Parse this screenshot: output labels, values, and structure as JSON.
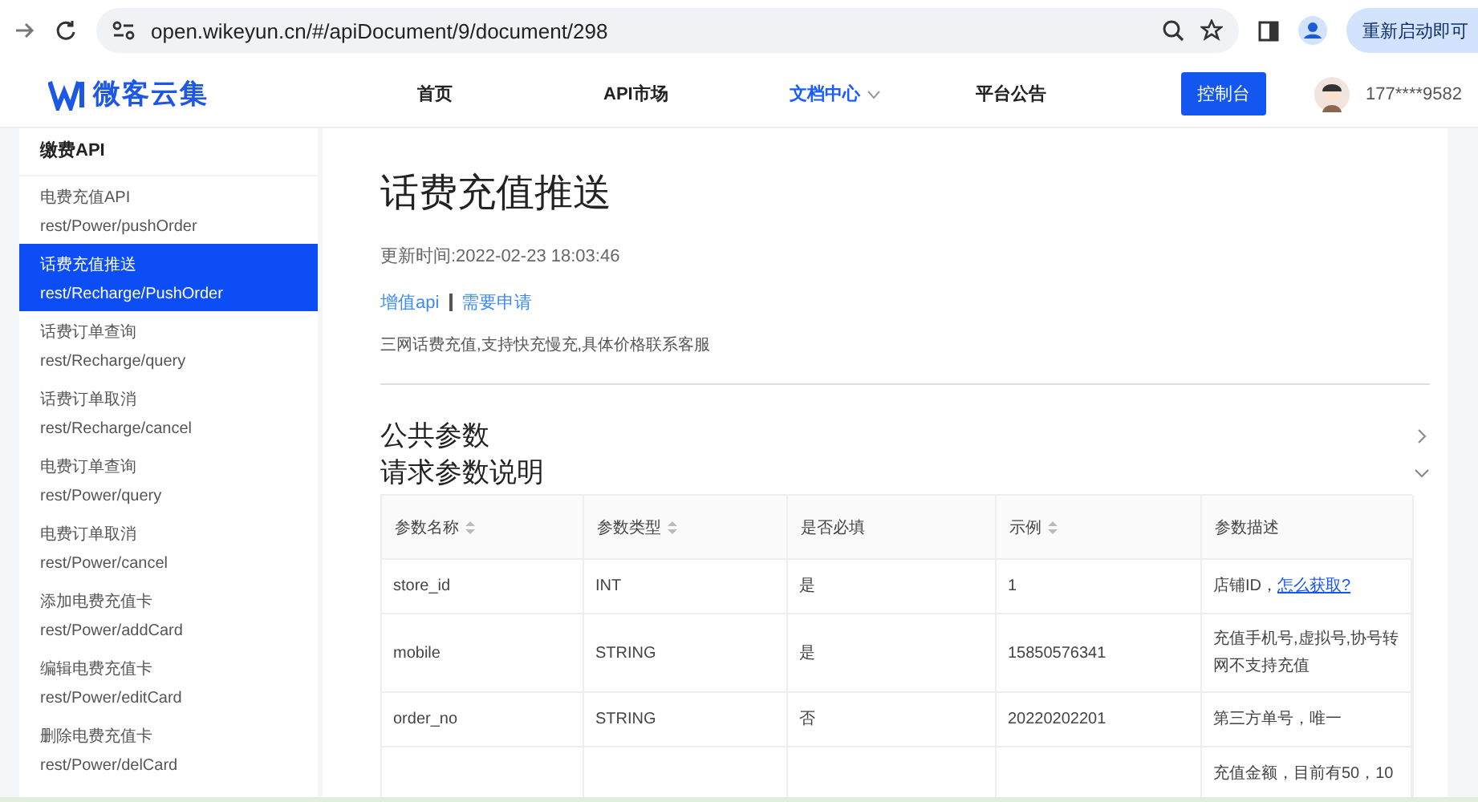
{
  "browser": {
    "url": "open.wikeyun.cn/#/apiDocument/9/document/298",
    "relaunch": "重新启动即可"
  },
  "header": {
    "logo": "微客云集",
    "nav": [
      {
        "label": "首页",
        "selected": false,
        "dropdown": false
      },
      {
        "label": "API市场",
        "selected": false,
        "dropdown": false
      },
      {
        "label": "文档中心",
        "selected": true,
        "dropdown": true
      },
      {
        "label": "平台公告",
        "selected": false,
        "dropdown": false
      }
    ],
    "console": "控制台",
    "user": "177****9582"
  },
  "sidebar": {
    "title": "缴费API",
    "items": [
      {
        "name": "电费充值API",
        "path": "rest/Power/pushOrder",
        "selected": false
      },
      {
        "name": "话费充值推送",
        "path": "rest/Recharge/PushOrder",
        "selected": true
      },
      {
        "name": "话费订单查询",
        "path": "rest/Recharge/query",
        "selected": false
      },
      {
        "name": "话费订单取消",
        "path": "rest/Recharge/cancel",
        "selected": false
      },
      {
        "name": "电费订单查询",
        "path": "rest/Power/query",
        "selected": false
      },
      {
        "name": "电费订单取消",
        "path": "rest/Power/cancel",
        "selected": false
      },
      {
        "name": "添加电费充值卡",
        "path": "rest/Power/addCard",
        "selected": false
      },
      {
        "name": "编辑电费充值卡",
        "path": "rest/Power/editCard",
        "selected": false
      },
      {
        "name": "删除电费充值卡",
        "path": "rest/Power/delCard",
        "selected": false
      }
    ]
  },
  "doc": {
    "title": "话费充值推送",
    "updated": "更新时间:2022-02-23 18:03:46",
    "tags": [
      "增值api",
      "需要申请"
    ],
    "description": "三网话费充值,支持快充慢充,具体价格联系客服",
    "sections": [
      {
        "title": "公共参数",
        "expanded": false
      },
      {
        "title": "请求参数说明",
        "expanded": true
      }
    ]
  },
  "table": {
    "columns": [
      {
        "label": "参数名称",
        "sortable": true
      },
      {
        "label": "参数类型",
        "sortable": true
      },
      {
        "label": "是否必填",
        "sortable": false
      },
      {
        "label": "示例",
        "sortable": true
      },
      {
        "label": "参数描述",
        "sortable": false
      }
    ],
    "rows": [
      {
        "cells": [
          "store_id",
          "INT",
          "是",
          "1",
          "店铺ID，"
        ],
        "link": "怎么获取?"
      },
      {
        "cells": [
          "mobile",
          "STRING",
          "是",
          "15850576341",
          "充值手机号,虚拟号,协号转网不支持充值"
        ]
      },
      {
        "cells": [
          "order_no",
          "STRING",
          "否",
          "20220202201",
          "第三方单号，唯一"
        ]
      },
      {
        "cells": [
          "",
          "",
          "",
          "",
          "充值金额，目前有50，10"
        ]
      }
    ]
  }
}
